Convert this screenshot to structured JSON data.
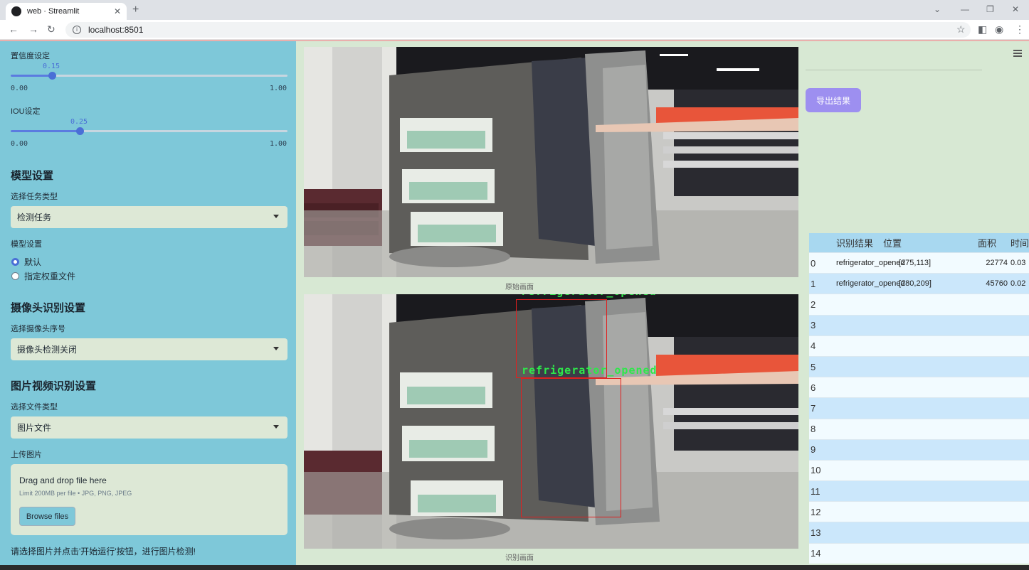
{
  "browser": {
    "tab_title": "web · Streamlit",
    "url": "localhost:8501"
  },
  "sidebar": {
    "confidence_label": "置信度设定",
    "confidence_value": "0.15",
    "confidence_fraction": 0.15,
    "confidence_min": "0.00",
    "confidence_max": "1.00",
    "iou_label": "IOU设定",
    "iou_value": "0.25",
    "iou_fraction": 0.25,
    "iou_min": "0.00",
    "iou_max": "1.00",
    "model_header": "模型设置",
    "task_type_label": "选择任务类型",
    "task_type_value": "检测任务",
    "model_settings_label": "模型设置",
    "radio_default": "默认",
    "radio_custom": "指定权重文件",
    "camera_header": "摄像头识别设置",
    "camera_select_label": "选择摄像头序号",
    "camera_select_value": "摄像头检测关闭",
    "media_header": "图片视频识别设置",
    "file_type_label": "选择文件类型",
    "file_type_value": "图片文件",
    "upload_label": "上传图片",
    "dropzone_title": "Drag and drop file here",
    "dropzone_limit": "Limit 200MB per file • JPG, PNG, JPEG",
    "browse_button": "Browse files",
    "hint": "请选择图片并点击'开始运行'按钮，进行图片检测!"
  },
  "main": {
    "original_caption": "原始画面",
    "result_caption": "识别画面",
    "detection_label": "refrigerator_opened"
  },
  "right": {
    "export_button": "导出结果",
    "table_headers": [
      "识别结果",
      "位置",
      "面积",
      "时间"
    ],
    "rows": [
      {
        "idx": "0",
        "result": "refrigerator_opened",
        "pos": "[275,113]",
        "area": "22774",
        "time": "0.03"
      },
      {
        "idx": "1",
        "result": "refrigerator_opened",
        "pos": "[280,209]",
        "area": "45760",
        "time": "0.02"
      },
      {
        "idx": "2",
        "result": "",
        "pos": "",
        "area": "",
        "time": ""
      },
      {
        "idx": "3",
        "result": "",
        "pos": "",
        "area": "",
        "time": ""
      },
      {
        "idx": "4",
        "result": "",
        "pos": "",
        "area": "",
        "time": ""
      },
      {
        "idx": "5",
        "result": "",
        "pos": "",
        "area": "",
        "time": ""
      },
      {
        "idx": "6",
        "result": "",
        "pos": "",
        "area": "",
        "time": ""
      },
      {
        "idx": "7",
        "result": "",
        "pos": "",
        "area": "",
        "time": ""
      },
      {
        "idx": "8",
        "result": "",
        "pos": "",
        "area": "",
        "time": ""
      },
      {
        "idx": "9",
        "result": "",
        "pos": "",
        "area": "",
        "time": ""
      },
      {
        "idx": "10",
        "result": "",
        "pos": "",
        "area": "",
        "time": ""
      },
      {
        "idx": "11",
        "result": "",
        "pos": "",
        "area": "",
        "time": ""
      },
      {
        "idx": "12",
        "result": "",
        "pos": "",
        "area": "",
        "time": ""
      },
      {
        "idx": "13",
        "result": "",
        "pos": "",
        "area": "",
        "time": ""
      },
      {
        "idx": "14",
        "result": "",
        "pos": "",
        "area": "",
        "time": ""
      }
    ]
  },
  "colors": {
    "sidebar_bg": "#7ec8d9",
    "main_bg": "#d7e8d3",
    "accent": "#4a6fd6",
    "export_bg": "#9d8ff0",
    "detection_box": "#e02020",
    "detection_text": "#2ee84a"
  }
}
